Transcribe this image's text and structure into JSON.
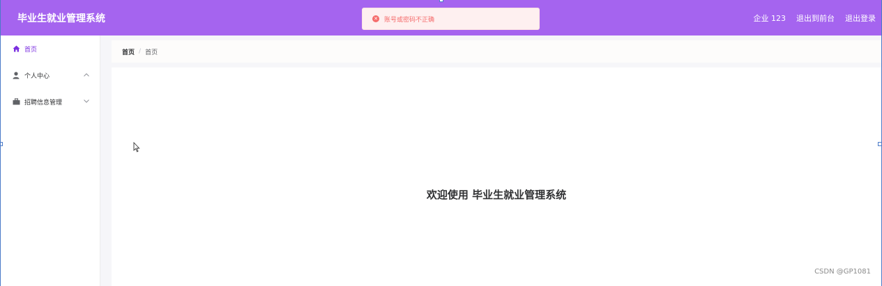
{
  "header": {
    "app_title": "毕业生就业管理系统",
    "user_label": "企业 123",
    "back_to_front": "退出到前台",
    "logout": "退出登录"
  },
  "toast": {
    "icon": "error-circle-icon",
    "message": "账号或密码不正确"
  },
  "sidebar": {
    "items": [
      {
        "label": "首页",
        "icon": "home-icon",
        "active": true
      },
      {
        "label": "个人中心",
        "icon": "user-icon",
        "expanded": true
      },
      {
        "label": "招聘信息管理",
        "icon": "briefcase-icon",
        "expanded": false
      }
    ]
  },
  "breadcrumb": {
    "home": "首页",
    "separator": "/",
    "current": "首页"
  },
  "main": {
    "welcome": "欢迎使用 毕业生就业管理系统"
  },
  "watermark": "CSDN @GP1081",
  "colors": {
    "header_bg": "#a564ef",
    "accent": "#7b2fe0",
    "error": "#f56c6c"
  }
}
